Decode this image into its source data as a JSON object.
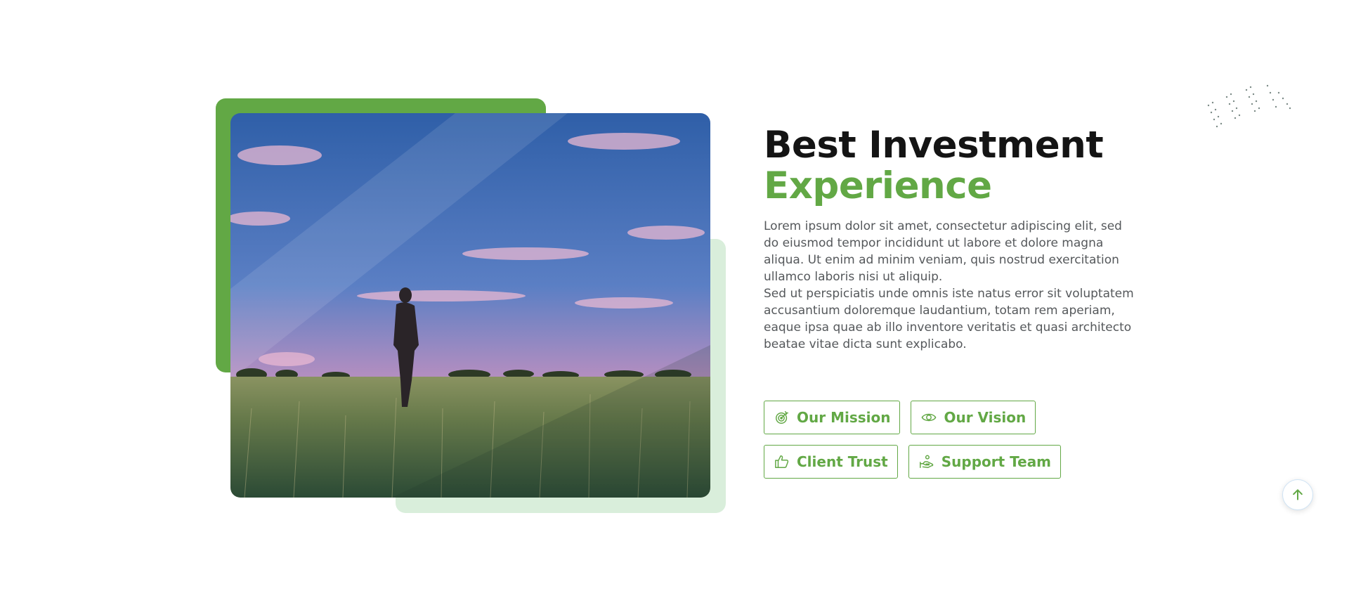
{
  "about": {
    "title_line1": "Best Investment",
    "title_line2": "Experience",
    "paragraph1": "Lorem ipsum dolor sit amet, consectetur adipiscing elit, sed do eiusmod tempor incididunt ut labore et dolore magna aliqua. Ut enim ad minim veniam, quis nostrud exercitation ullamco laboris nisi ut aliquip.",
    "paragraph2": "Sed ut perspiciatis unde omnis iste natus error sit voluptatem accusantium doloremque laudantium, totam rem aperiam, eaque ipsa quae ab illo inventore veritatis et quasi architecto beatae vitae dicta sunt explicabo.",
    "buttons": [
      {
        "label": "Our Mission",
        "icon": "target-icon"
      },
      {
        "label": "Our Vision",
        "icon": "eye-icon"
      },
      {
        "label": "Client Trust",
        "icon": "thumbs-up-icon"
      },
      {
        "label": "Support Team",
        "icon": "hand-support-icon"
      }
    ]
  },
  "image": {
    "subject": "person-standing-in-wheat-field-at-sunset"
  },
  "colors": {
    "accent": "#62a845",
    "accent_light": "#d9eedb",
    "heading": "#141414",
    "body_text": "#55585b"
  },
  "scroll_top": {
    "icon": "arrow-up-icon"
  }
}
